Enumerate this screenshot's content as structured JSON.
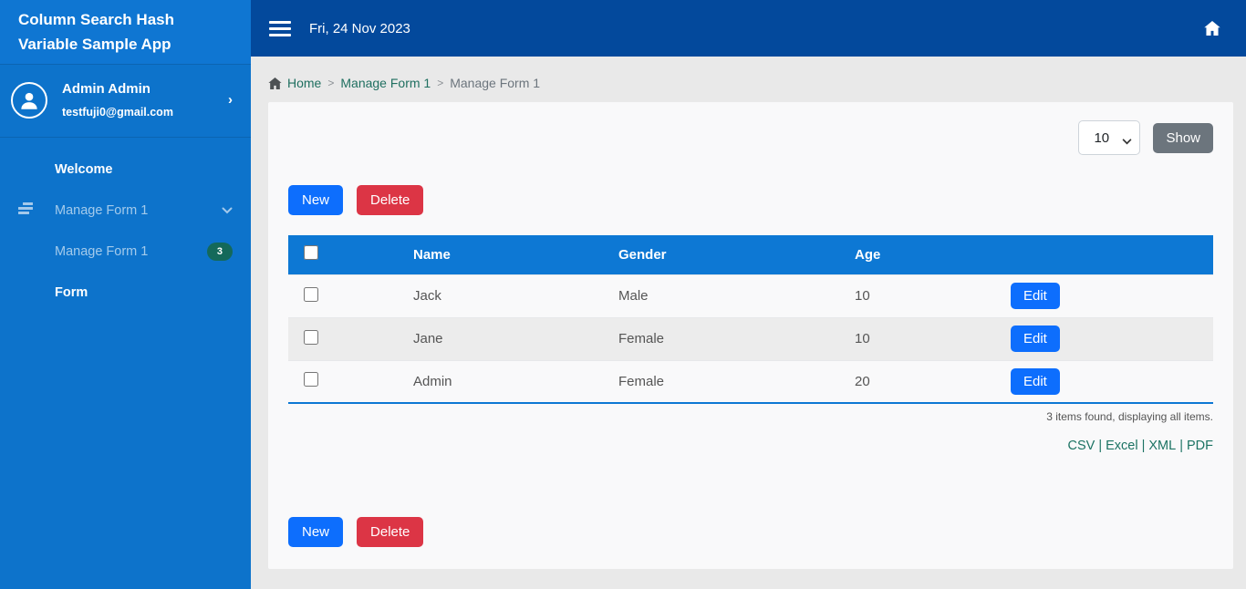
{
  "app": {
    "title": "Column Search Hash Variable Sample App"
  },
  "topbar": {
    "date": "Fri, 24 Nov 2023"
  },
  "sidebar": {
    "user": {
      "name": "Admin Admin",
      "email": "testfuji0@gmail.com"
    },
    "menu": {
      "welcome": "Welcome",
      "manage_form_parent": "Manage Form 1",
      "manage_form_child": "Manage Form 1",
      "manage_form_child_badge": "3",
      "form": "Form"
    }
  },
  "breadcrumb": {
    "home": "Home",
    "level1": "Manage Form 1",
    "level2": "Manage Form 1",
    "separator": ">"
  },
  "toolbar": {
    "page_size": "10",
    "show": "Show",
    "new": "New",
    "delete": "Delete"
  },
  "table": {
    "headers": {
      "name": "Name",
      "gender": "Gender",
      "age": "Age"
    },
    "edit_label": "Edit",
    "rows": [
      {
        "name": "Jack",
        "gender": "Male",
        "age": "10"
      },
      {
        "name": "Jane",
        "gender": "Female",
        "age": "10"
      },
      {
        "name": "Admin",
        "gender": "Female",
        "age": "20"
      }
    ],
    "status": "3 items found, displaying all items.",
    "exports": {
      "csv": "CSV",
      "excel": "Excel",
      "xml": "XML",
      "pdf": "PDF",
      "separator": "|"
    }
  },
  "colors": {
    "sidebar_blue": "#0d73cb",
    "topbar_blue": "#03499c",
    "table_header_blue": "#0d78d4",
    "primary": "#0d6efd",
    "danger": "#dc3545",
    "secondary": "#6c757d",
    "link_teal": "#1c7363",
    "badge_teal": "#14695a",
    "page_bg": "#e9e9e9",
    "card_bg": "#f9f9fa",
    "stripe": "#ececec"
  }
}
